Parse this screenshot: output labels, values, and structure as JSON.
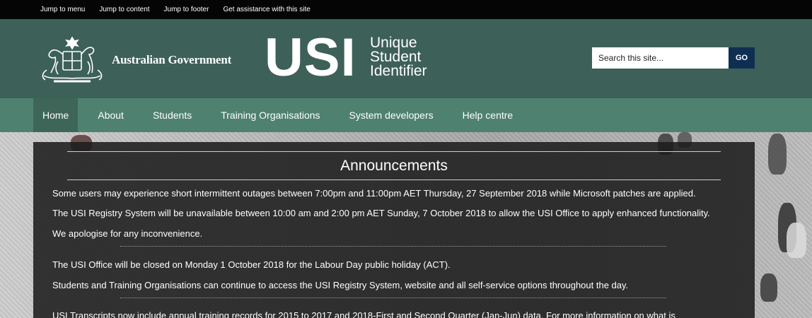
{
  "skip_links": [
    "Jump to menu",
    "Jump to content",
    "Jump to footer",
    "Get assistance with this site"
  ],
  "header": {
    "gov_name": "Australian Government",
    "logo_main": "USI",
    "logo_sub": [
      "Unique",
      "Student",
      "Identifier"
    ],
    "search_placeholder": "Search this site...",
    "search_button": "GO"
  },
  "nav": {
    "items": [
      "Home",
      "About",
      "Students",
      "Training Organisations",
      "System developers",
      "Help centre"
    ],
    "active_index": 0
  },
  "announcements": {
    "title": "Announcements",
    "paragraphs": [
      "Some users may experience short intermittent outages between 7:00pm and 11:00pm AET Thursday, 27 September 2018 while Microsoft patches are applied.",
      "The USI Registry System will be unavailable between 10:00 am and 2:00 pm AET Sunday, 7 October 2018 to allow the USI Office to apply enhanced functionality.",
      "We apologise for any inconvenience.",
      "The USI Office will be closed on Monday 1 October 2018 for the Labour Day public holiday (ACT).",
      "Students and Training Organisations can continue to access the USI Registry System, website and all self-service options throughout the day.",
      "USI Transcripts now include annual training records for 2015 to 2017 and 2018-First and Second Quarter (Jan-Jun) data. For more information on what is"
    ]
  },
  "colors": {
    "header_bg": "#3d6058",
    "nav_bg": "#4e8170",
    "nav_active_bg": "#3d6658",
    "search_button_bg": "#0f2f52",
    "announce_bg": "#1c1c1c"
  },
  "icons": {
    "crest": "australian-coat-of-arms-icon"
  }
}
